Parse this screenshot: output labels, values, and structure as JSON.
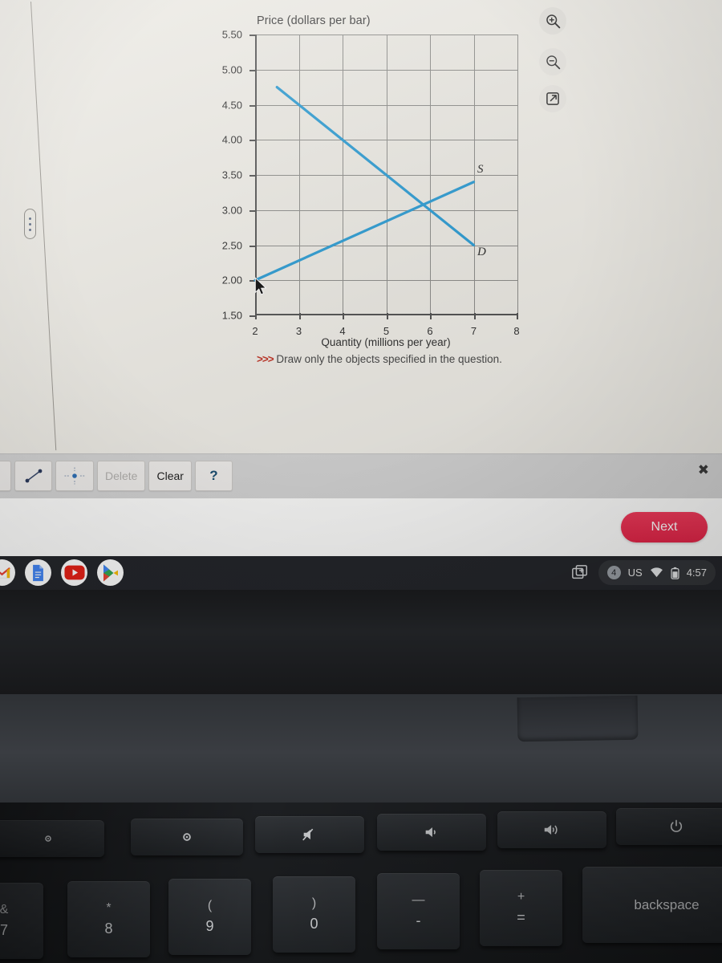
{
  "chart_data": {
    "type": "line",
    "title": "Price (dollars per bar)",
    "xlabel": "Quantity (millions per year)",
    "ylabel": "Price (dollars per bar)",
    "xlim": [
      2,
      8
    ],
    "ylim": [
      1.5,
      5.5
    ],
    "x_ticks": [
      "2",
      "3",
      "4",
      "5",
      "6",
      "7",
      "8"
    ],
    "y_ticks": [
      "5.50",
      "5.00",
      "4.50",
      "4.00",
      "3.50",
      "3.00",
      "2.50",
      "2.00",
      "1.50"
    ],
    "grid": true,
    "legend": "inline-labels",
    "series": [
      {
        "name": "D",
        "label": "D",
        "color": "#2e9bd1",
        "points": [
          [
            2.5,
            4.75
          ],
          [
            7.0,
            2.5
          ]
        ]
      },
      {
        "name": "S",
        "label": "S",
        "color": "#2e9bd1",
        "points": [
          [
            2.0,
            2.0
          ],
          [
            7.0,
            3.4
          ]
        ]
      }
    ],
    "equilibrium": [
      6.0,
      3.0
    ],
    "annotations": [
      {
        "text": "S",
        "x": 7.05,
        "y": 3.58
      },
      {
        "text": "D",
        "x": 7.05,
        "y": 2.4
      }
    ]
  },
  "chart_controls": [
    {
      "name": "zoom-in",
      "label": "+"
    },
    {
      "name": "zoom-out",
      "label": "−"
    },
    {
      "name": "popout",
      "label": "↗"
    }
  ],
  "hint": {
    "chevrons": ">>>",
    "text": "Draw only the objects specified in the question."
  },
  "toolbar": {
    "buttons": [
      {
        "name": "blank-tool",
        "label": ""
      },
      {
        "name": "line-tool",
        "label": ""
      },
      {
        "name": "point-tool",
        "label": ""
      },
      {
        "name": "delete",
        "label": "Delete",
        "disabled": true
      },
      {
        "name": "clear",
        "label": "Clear",
        "disabled": false
      },
      {
        "name": "help",
        "label": "?",
        "disabled": false
      }
    ],
    "close_label": "✖"
  },
  "footer": {
    "next_label": "Next"
  },
  "shelf": {
    "apps": [
      "gmail-icon",
      "docs-icon",
      "youtube-icon",
      "play-store-icon"
    ],
    "capture_icon": "screen-capture-icon",
    "tray": {
      "notification_count": "4",
      "keyboard_layout": "US",
      "wifi_icon": "wifi-icon",
      "battery_icon": "battery-icon",
      "time": "4:57"
    }
  },
  "keyboard": {
    "fn_row": [
      {
        "name": "key-brightness-down",
        "glyph": "☀"
      },
      {
        "name": "key-brightness-up",
        "glyph": "☀"
      },
      {
        "name": "key-mute",
        "glyph": " "
      },
      {
        "name": "key-volume-down",
        "glyph": "◂)"
      },
      {
        "name": "key-volume-up",
        "glyph": "◂))"
      },
      {
        "name": "key-power",
        "glyph": "⏻"
      }
    ],
    "number_row": [
      {
        "name": "key-7-ampersand",
        "upper": "&",
        "lower": "7"
      },
      {
        "name": "key-8-asterisk",
        "upper": "*",
        "lower": "8"
      },
      {
        "name": "key-9-paren-open",
        "upper": "(",
        "lower": "9"
      },
      {
        "name": "key-0-paren-close",
        "upper": ")",
        "lower": "0"
      },
      {
        "name": "key-minus-underscore",
        "upper": "—",
        "lower": "-"
      },
      {
        "name": "key-equals-plus",
        "upper": "+",
        "lower": "="
      },
      {
        "name": "key-backspace",
        "upper": "",
        "lower": "backspace"
      }
    ]
  }
}
